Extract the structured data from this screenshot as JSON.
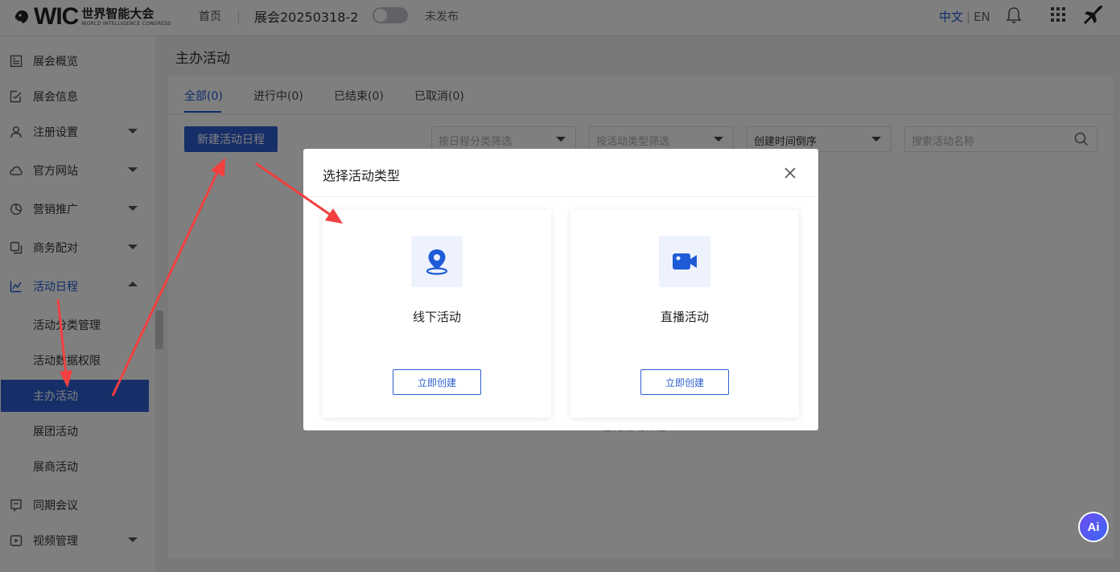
{
  "topbar": {
    "logo_text": "WIC",
    "logo_cn": "世界智能大会",
    "logo_en": "WORLD INTELLIGENCE CONGRESS",
    "home": "首页",
    "exhibition_title": "展会20250318-2",
    "publish_status": "未发布",
    "lang_zh": "中文",
    "lang_sep": "|",
    "lang_en": "EN",
    "icons": [
      "bell-icon",
      "apps-grid-icon",
      "plane-icon"
    ]
  },
  "sidebar": {
    "items": [
      {
        "label": "展会概览",
        "icon": "overview-icon"
      },
      {
        "label": "展会信息",
        "icon": "info-icon"
      },
      {
        "label": "注册设置",
        "icon": "user-icon",
        "expandable": true
      },
      {
        "label": "官方网站",
        "icon": "cloud-icon",
        "expandable": true
      },
      {
        "label": "营销推广",
        "icon": "pie-icon",
        "expandable": true
      },
      {
        "label": "商务配对",
        "icon": "copy-icon",
        "expandable": true
      },
      {
        "label": "活动日程",
        "icon": "schedule-icon",
        "expandable": true,
        "expanded": true
      },
      {
        "label": "同期会议",
        "icon": "meeting-icon"
      },
      {
        "label": "视频管理",
        "icon": "video-icon",
        "expandable": true
      }
    ],
    "sub_items": [
      {
        "label": "活动分类管理"
      },
      {
        "label": "活动数据权限"
      },
      {
        "label": "主办活动",
        "selected": true
      },
      {
        "label": "展团活动"
      },
      {
        "label": "展商活动"
      }
    ]
  },
  "main": {
    "page_title": "主办活动",
    "tabs": [
      {
        "label": "全部(0)",
        "active": true
      },
      {
        "label": "进行中(0)"
      },
      {
        "label": "已结束(0)"
      },
      {
        "label": "已取消(0)"
      }
    ],
    "new_button": "新建活动日程",
    "filters": {
      "category_placeholder": "按日程分类筛选",
      "type_placeholder": "按活动类型筛选",
      "sort_value": "创建时间倒序",
      "search_placeholder": "搜索活动名称"
    },
    "empty_text": "暂无活动日程"
  },
  "modal": {
    "title": "选择活动类型",
    "cards": [
      {
        "name": "线下活动",
        "button": "立即创建",
        "icon": "location-pin-icon"
      },
      {
        "name": "直播活动",
        "button": "立即创建",
        "icon": "video-camera-icon"
      }
    ]
  },
  "floating": {
    "ai_label": "Ai"
  },
  "colors": {
    "accent": "#2f5fd0",
    "annotation": "#f04040"
  }
}
